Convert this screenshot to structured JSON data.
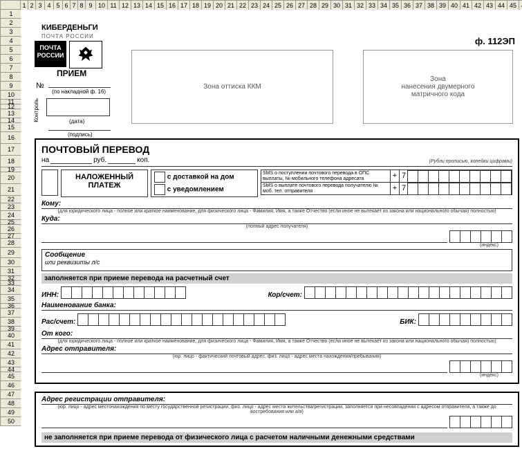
{
  "app": {
    "form_code": "ф. 112ЭП",
    "brand": "КИБЕРДЕНЬГИ",
    "brand_sub": "ПОЧТА РОССИИ",
    "pochta": "ПОЧТА РОССИИ",
    "priem": "ПРИЕМ",
    "num_sym": "№",
    "num_note": "(по накладной ф. 16)",
    "kontrol": "Контроль",
    "date_lbl": "(дата)",
    "sign_lbl": "(подпись)",
    "zone1": "Зона оттиска ККМ",
    "zone2": "Зона\nнанесения двумерного\nматричного кода"
  },
  "cols": [
    10,
    10,
    12,
    12,
    12,
    10,
    10,
    10,
    14,
    16,
    16,
    16,
    16,
    16,
    16,
    16,
    16,
    16,
    16,
    16,
    16,
    16,
    16,
    16,
    16,
    16,
    16,
    16,
    16,
    16,
    16,
    16,
    16,
    16,
    16,
    16,
    16,
    16,
    16,
    16,
    16,
    16,
    16,
    16,
    16,
    16,
    16,
    16,
    16,
    16,
    16,
    16,
    16,
    16,
    16,
    10,
    10
  ],
  "rows": [
    12,
    12,
    12,
    12,
    12,
    12,
    12,
    12,
    12,
    12,
    6,
    6,
    12,
    6,
    12,
    16,
    16,
    16,
    6,
    16,
    16,
    10,
    10,
    12,
    6,
    12,
    6,
    12,
    14,
    12,
    12,
    6,
    6,
    12,
    12,
    6,
    12,
    12,
    6,
    12,
    12,
    12,
    12,
    6,
    12,
    12,
    12,
    12,
    12,
    12
  ],
  "main": {
    "title": "ПОЧТОВЫЙ ПЕРЕВОД",
    "na": "на",
    "rub": "руб.",
    "kop": "коп.",
    "rub_note": "(Рубли прописью, копейки цифрами)",
    "nalozh": "НАЛОЖЕННЫЙ ПЛАТЕЖ",
    "delivery": "с доставкой на дом",
    "notify": "с уведомлением",
    "sms1": "SMS о поступлении почтового перевода в ОПС выплаты, № мобильного телефона адресата",
    "sms2": "SMS о выплате почтового перевода получателю № моб. тел. отправителя",
    "plus": "+",
    "seven": "7",
    "komu": "Кому:",
    "komu_note": "(для юридического лица - полное или краткое наименование, для физического лица - Фамилия, Имя, а также Отчество (если иное не вытекает из закона или национального обычая) полностью)",
    "kuda": "Куда:",
    "kuda_note": "(полный адрес получателя)",
    "index": "(индекс)",
    "msg": "Сообщение",
    "msg_sub": "или реквизиты л/с",
    "gray1": "заполняется при приеме перевода на расчетный счет",
    "inn": "ИНН:",
    "kor": "Кор/счет:",
    "bank": "Наименование банка:",
    "ras": "Рас/счет:",
    "bik": "БИК:",
    "otkogo": "От кого:",
    "otkogo_note": "(для юридического лица - полное или краткое наименование, для физического лица - Фамилия, Имя, а также Отчество (если иное не вытекает из закона или национального обычая) полностью)",
    "adr_send": "Адрес отправителя:",
    "adr_send_note": "(юр. лицо - фактический почтовый адрес, физ. лицо - адрес места нахождения/пребывания)"
  },
  "frame2": {
    "adr_reg": "Адрес регистрации отправителя:",
    "adr_reg_note": "(юр. лицо - адрес местонахождения по месту государственной регистрации, физ. лицо - адрес места жительства/регистрации, заполняется при несовпадении с адресом отправителя, а также до востребования или а/я)",
    "gray2": "не заполняется при приеме перевода от физического лица с расчетом наличными денежными средствами"
  }
}
